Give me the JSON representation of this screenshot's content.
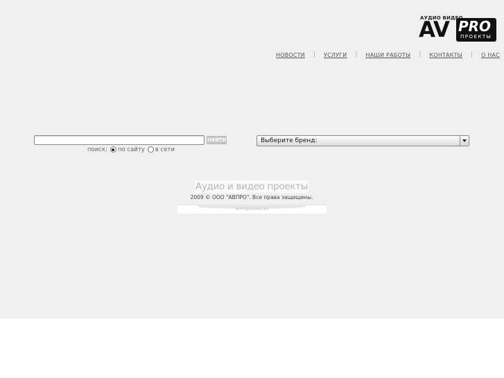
{
  "logo": {
    "top_text": "АУДИО ВИДЕО",
    "main_text": "AV",
    "badge_text": "PRO",
    "sub_text": "ПРОЕКТЫ"
  },
  "nav": {
    "items": [
      "НОВОСТИ",
      "УСЛУГИ",
      "НАШИ РАБОТЫ",
      "КОНТАКТЫ",
      "О НАС"
    ],
    "separator": "|"
  },
  "search": {
    "input_value": "",
    "button_label": "НАЙТИ",
    "scope_label": "поиск:",
    "options": [
      "по сайту",
      "в сети"
    ],
    "selected_option": "по сайту"
  },
  "brand_select": {
    "selected_label": "Выберите бренд:"
  },
  "footer": {
    "tagline": "Аудио и видео проекты",
    "copyright": "2009 © ООО \"АВПРО\". Все права защищены.",
    "email": "INFO@AVPRO.BY"
  },
  "colors": {
    "page_background": "#f0f0f0",
    "text_primary": "#555555",
    "logo": "#111111"
  }
}
